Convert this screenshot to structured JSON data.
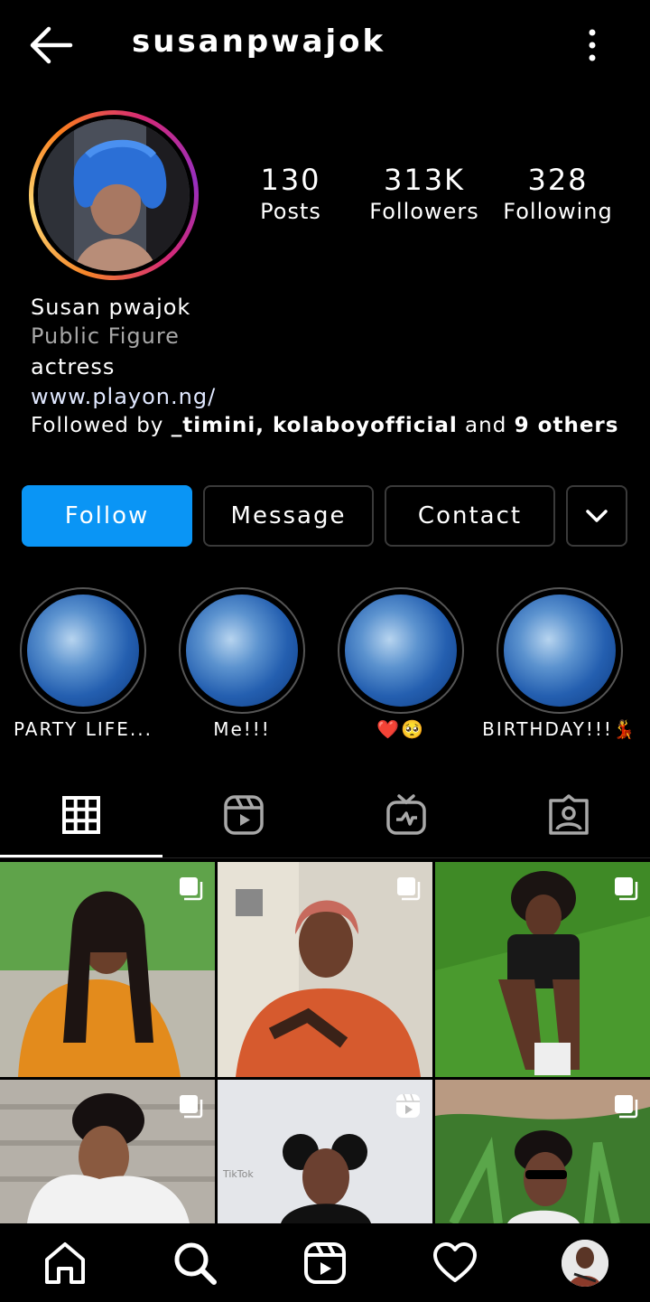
{
  "header": {
    "username": "susanpwajok",
    "back_icon": "arrow-left-icon",
    "more_icon": "more-vertical-icon"
  },
  "stats": [
    {
      "value": "130",
      "label": "Posts"
    },
    {
      "value": "313K",
      "label": "Followers"
    },
    {
      "value": "328",
      "label": "Following"
    }
  ],
  "bio": {
    "name": "Susan pwajok",
    "category": "Public Figure",
    "text": "actress",
    "link": "www.playon.ng/",
    "followed_by_prefix": "Followed by ",
    "followed_by_names": "_timini, kolaboyofficial",
    "followed_by_mid": " and ",
    "followed_by_others": "9 others"
  },
  "actions": {
    "follow": "Follow",
    "message": "Message",
    "contact": "Contact",
    "dropdown_icon": "chevron-down-icon"
  },
  "highlights": [
    {
      "label": "PARTY LIFE..."
    },
    {
      "label": "Me!!!"
    },
    {
      "label": "❤️🥺"
    },
    {
      "label": "BIRTHDAY!!!💃"
    }
  ],
  "tabs": [
    {
      "icon": "grid-icon",
      "active": true
    },
    {
      "icon": "reels-icon",
      "active": false
    },
    {
      "icon": "igtv-icon",
      "active": false
    },
    {
      "icon": "tagged-icon",
      "active": false
    }
  ],
  "grid": [
    {
      "badge": "multi-photo-icon"
    },
    {
      "badge": "multi-photo-icon"
    },
    {
      "badge": "multi-photo-icon"
    },
    {
      "badge": "multi-photo-icon"
    },
    {
      "badge": "reels-icon",
      "watermark": "TikTok"
    },
    {
      "badge": "multi-photo-icon"
    }
  ],
  "bottom_nav": [
    "home-icon",
    "search-icon",
    "reels-icon",
    "heart-icon",
    "profile-avatar"
  ],
  "colors": {
    "follow_button": "#0a95f5",
    "link": "#e0e8ff",
    "category": "#a8a8a8",
    "border": "#3a3a3a"
  }
}
